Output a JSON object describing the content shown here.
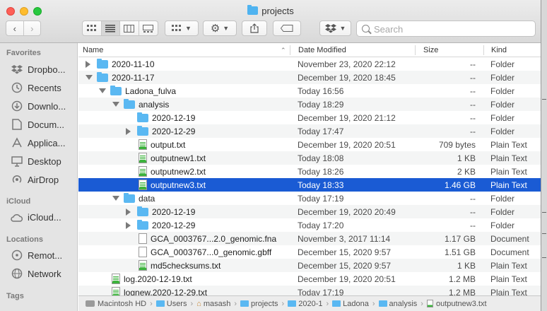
{
  "window": {
    "title": "projects"
  },
  "toolbar": {
    "back_icon": "chevron-left",
    "forward_icon": "chevron-right",
    "view_modes": [
      "icon-view",
      "list-view",
      "column-view",
      "gallery-view"
    ],
    "group_icon": "grid-group",
    "action_icon": "gear",
    "share_icon": "share",
    "tag_icon": "tag",
    "dropbox_icon": "dropbox",
    "search_placeholder": "Search"
  },
  "sidebar": {
    "sections": [
      {
        "title": "Favorites",
        "items": [
          {
            "label": "Dropbo...",
            "icon": "dropbox-icon"
          },
          {
            "label": "Recents",
            "icon": "clock-icon"
          },
          {
            "label": "Downlo...",
            "icon": "download-icon"
          },
          {
            "label": "Docum...",
            "icon": "document-icon"
          },
          {
            "label": "Applica...",
            "icon": "applications-icon"
          },
          {
            "label": "Desktop",
            "icon": "desktop-icon"
          },
          {
            "label": "AirDrop",
            "icon": "airdrop-icon"
          }
        ]
      },
      {
        "title": "iCloud",
        "items": [
          {
            "label": "iCloud...",
            "icon": "cloud-icon"
          }
        ]
      },
      {
        "title": "Locations",
        "items": [
          {
            "label": "Remot...",
            "icon": "disc-icon"
          },
          {
            "label": "Network",
            "icon": "globe-icon"
          }
        ]
      },
      {
        "title": "Tags",
        "items": []
      }
    ]
  },
  "columns": {
    "name": "Name",
    "date": "Date Modified",
    "size": "Size",
    "kind": "Kind"
  },
  "rows": [
    {
      "level": 0,
      "disclosure": "closed",
      "icon": "folder",
      "name": "2020-11-10",
      "date": "November 23, 2020 22:12",
      "size": "--",
      "kind": "Folder"
    },
    {
      "level": 0,
      "disclosure": "open",
      "icon": "folder",
      "name": "2020-11-17",
      "date": "December 19, 2020 18:45",
      "size": "--",
      "kind": "Folder"
    },
    {
      "level": 1,
      "disclosure": "open",
      "icon": "folder",
      "name": "Ladona_fulva",
      "date": "Today 16:56",
      "size": "--",
      "kind": "Folder"
    },
    {
      "level": 2,
      "disclosure": "open",
      "icon": "folder",
      "name": "analysis",
      "date": "Today 18:29",
      "size": "--",
      "kind": "Folder"
    },
    {
      "level": 3,
      "disclosure": "none",
      "icon": "folder",
      "name": "2020-12-19",
      "date": "December 19, 2020 21:12",
      "size": "--",
      "kind": "Folder"
    },
    {
      "level": 3,
      "disclosure": "closed",
      "icon": "folder",
      "name": "2020-12-29",
      "date": "Today 17:47",
      "size": "--",
      "kind": "Folder"
    },
    {
      "level": 3,
      "disclosure": "none",
      "icon": "text",
      "name": "output.txt",
      "date": "December 19, 2020 20:51",
      "size": "709 bytes",
      "kind": "Plain Text"
    },
    {
      "level": 3,
      "disclosure": "none",
      "icon": "text",
      "name": "outputnew1.txt",
      "date": "Today 18:08",
      "size": "1 KB",
      "kind": "Plain Text"
    },
    {
      "level": 3,
      "disclosure": "none",
      "icon": "text",
      "name": "outputnew2.txt",
      "date": "Today 18:26",
      "size": "2 KB",
      "kind": "Plain Text"
    },
    {
      "level": 3,
      "disclosure": "none",
      "icon": "text",
      "name": "outputnew3.txt",
      "date": "Today 18:33",
      "size": "1.46 GB",
      "kind": "Plain Text",
      "selected": true
    },
    {
      "level": 2,
      "disclosure": "open",
      "icon": "folder",
      "name": "data",
      "date": "Today 17:19",
      "size": "--",
      "kind": "Folder"
    },
    {
      "level": 3,
      "disclosure": "closed",
      "icon": "folder",
      "name": "2020-12-19",
      "date": "December 19, 2020 20:49",
      "size": "--",
      "kind": "Folder"
    },
    {
      "level": 3,
      "disclosure": "closed",
      "icon": "folder",
      "name": "2020-12-29",
      "date": "Today 17:20",
      "size": "--",
      "kind": "Folder"
    },
    {
      "level": 3,
      "disclosure": "none",
      "icon": "document",
      "name": "GCA_0003767...2.0_genomic.fna",
      "date": "November 3, 2017 11:14",
      "size": "1.17 GB",
      "kind": "Document"
    },
    {
      "level": 3,
      "disclosure": "none",
      "icon": "document",
      "name": "GCA_0003767...0_genomic.gbff",
      "date": "December 15, 2020 9:57",
      "size": "1.51 GB",
      "kind": "Document"
    },
    {
      "level": 3,
      "disclosure": "none",
      "icon": "text",
      "name": "md5checksums.txt",
      "date": "December 15, 2020 9:57",
      "size": "1 KB",
      "kind": "Plain Text"
    },
    {
      "level": 1,
      "disclosure": "none",
      "icon": "text",
      "name": "log.2020-12-19.txt",
      "date": "December 19, 2020 20:51",
      "size": "1.2 MB",
      "kind": "Plain Text"
    },
    {
      "level": 1,
      "disclosure": "none",
      "icon": "text",
      "name": "lognew.2020-12-29.txt",
      "date": "Today 17:19",
      "size": "1.2 MB",
      "kind": "Plain Text"
    }
  ],
  "pathbar": [
    {
      "label": "Macintosh HD",
      "icon": "drive"
    },
    {
      "label": "Users",
      "icon": "folder"
    },
    {
      "label": "masash",
      "icon": "home"
    },
    {
      "label": "projects",
      "icon": "folder"
    },
    {
      "label": "2020-1",
      "icon": "folder"
    },
    {
      "label": "Ladona",
      "icon": "folder"
    },
    {
      "label": "analysis",
      "icon": "folder"
    },
    {
      "label": "outputnew3.txt",
      "icon": "text"
    }
  ],
  "colors": {
    "selection": "#1a5bd4",
    "folder": "#5ab8f2",
    "text_file_accent": "#3db33d"
  }
}
